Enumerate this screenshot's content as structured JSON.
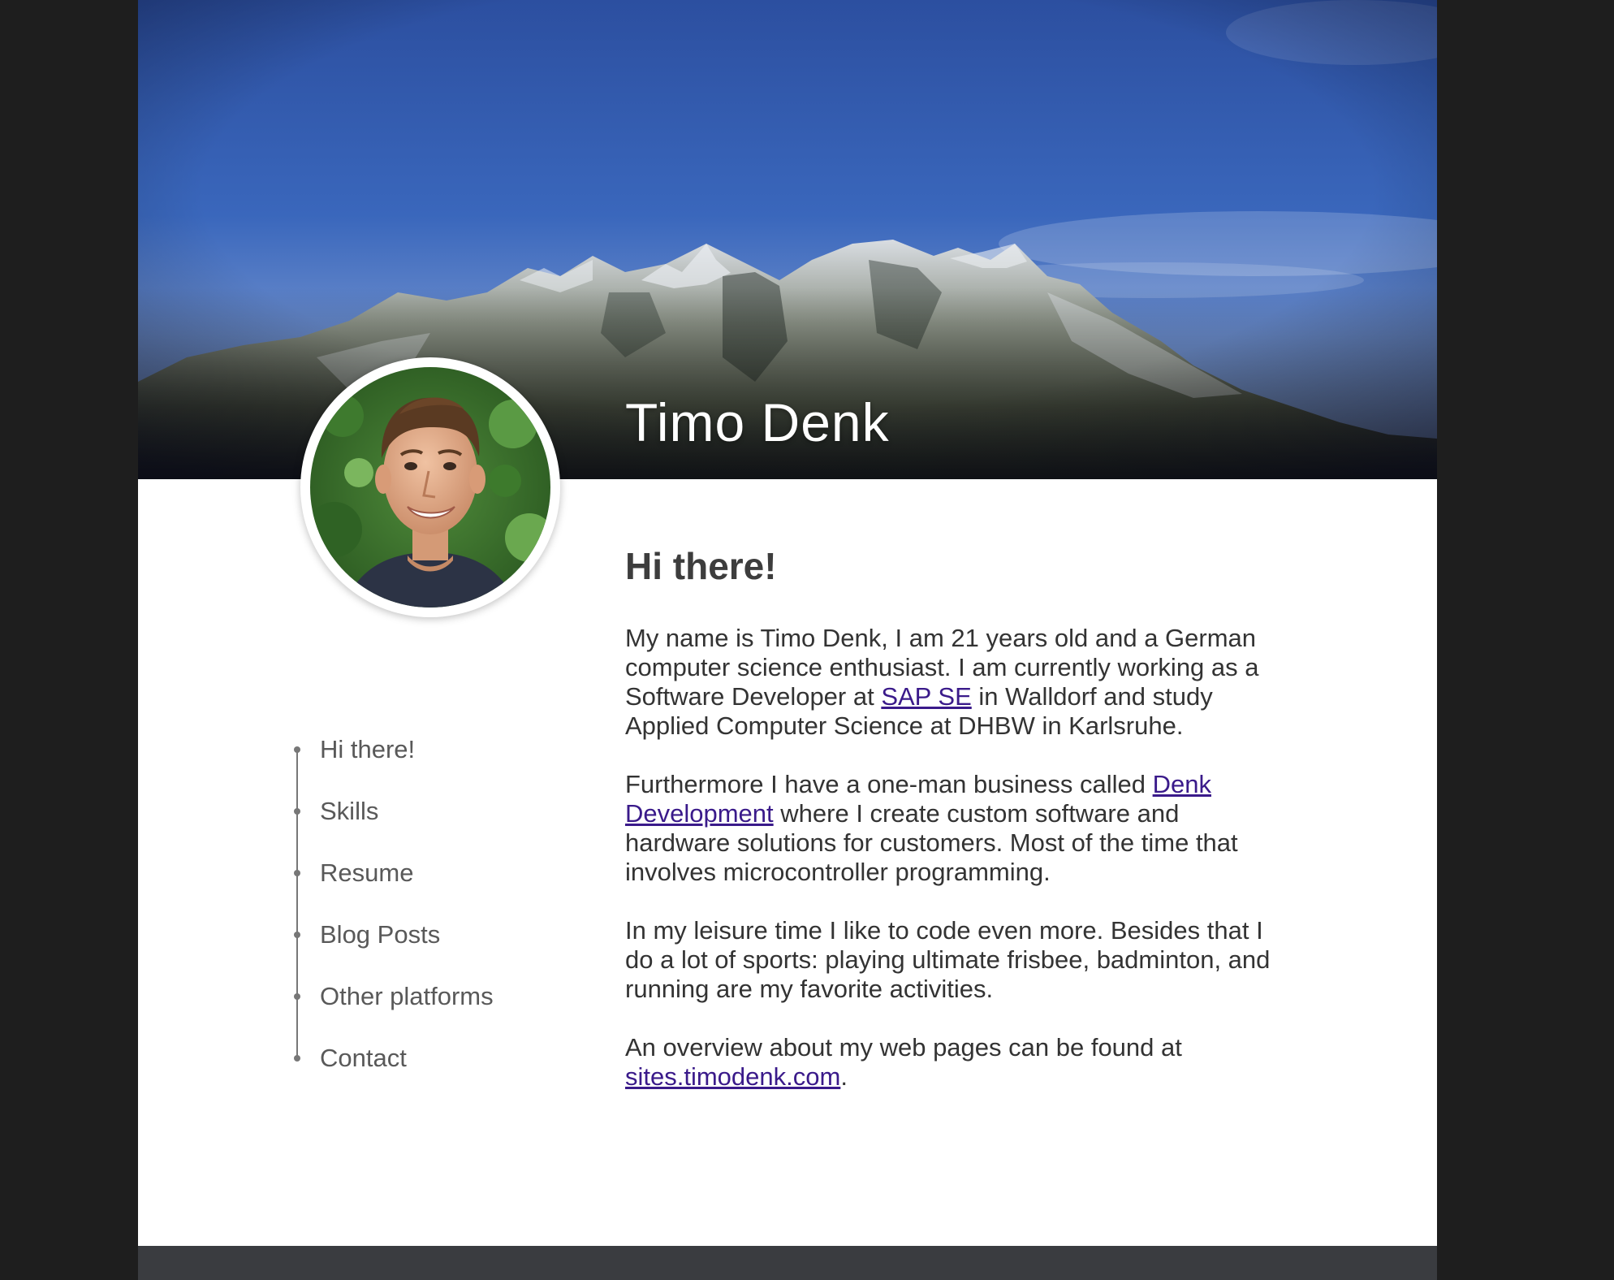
{
  "header": {
    "name": "Timo Denk"
  },
  "nav": {
    "items": [
      {
        "label": "Hi there!"
      },
      {
        "label": "Skills"
      },
      {
        "label": "Resume"
      },
      {
        "label": "Blog Posts"
      },
      {
        "label": "Other platforms"
      },
      {
        "label": "Contact"
      }
    ]
  },
  "intro": {
    "heading": "Hi there!",
    "p1_a": "My name is Timo Denk, I am 21 years old and a German computer science enthusiast. I am currently working as a Software Developer at ",
    "p1_link": "SAP SE",
    "p1_b": " in Walldorf and study Applied Computer Science at DHBW in Karlsruhe.",
    "p2_a": "Furthermore I have a one-man business called ",
    "p2_link": "Denk Development",
    "p2_b": " where I create custom software and hardware solutions for customers. Most of the time that involves microcontroller programming.",
    "p3": "In my leisure time I like to code even more. Besides that I do a lot of sports: playing ultimate frisbee, badminton, and running are my favorite activities.",
    "p4_a": "An overview about my web pages can be found at ",
    "p4_link": "sites.timodenk.com",
    "p4_b": "."
  },
  "colors": {
    "link": "#3a1a8a",
    "text": "#333333",
    "footer": "#3a3c40",
    "sky": "#3563b8"
  },
  "icons": {
    "hero": "mountain-photo",
    "avatar": "profile-photo"
  }
}
